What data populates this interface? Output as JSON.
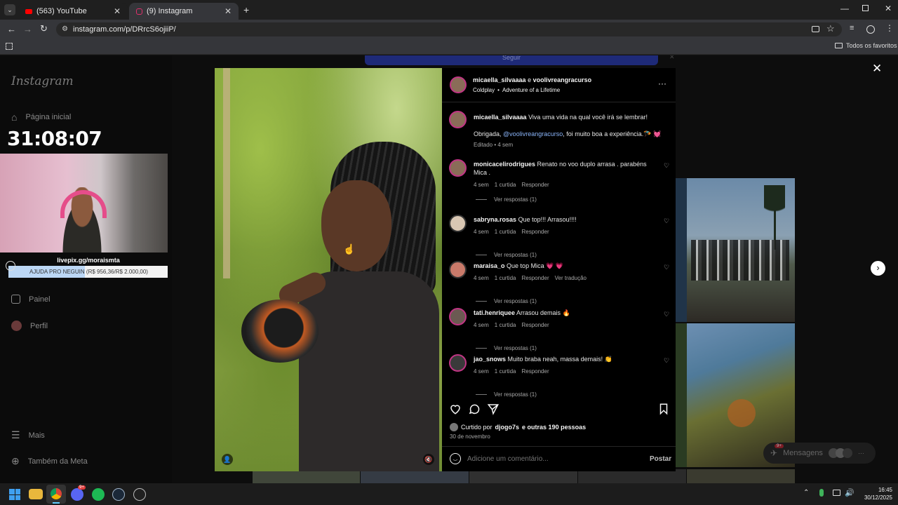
{
  "browser": {
    "tabs": [
      {
        "label": "(563) YouTube",
        "active": false
      },
      {
        "label": "(9) Instagram",
        "active": true
      }
    ],
    "url": "instagram.com/p/DRrcS6ojiiP/",
    "bookmarks_label": "Todos os favoritos"
  },
  "instagram": {
    "logo": "Instagram",
    "follow_label": "Seguir",
    "sidebar": {
      "home": "Página inicial",
      "panel": "Painel",
      "profile": "Perfil",
      "more": "Mais",
      "meta": "Também da Meta"
    },
    "messages_label": "Mensagens",
    "messages_badge": "9+"
  },
  "stream_overlay": {
    "timer": "31:08:07",
    "link": "livepix.gg/moraismta",
    "goal_text": "AJUDA PRO NEGUIN (R$ 956,36/R$ 2.000,00)",
    "goal_progress": 0.478
  },
  "post": {
    "author": "micaella_silvaaaa",
    "and_text": "e",
    "collaborator": "voolivreangracurso",
    "music_artist": "Coldplay",
    "music_sep": "•",
    "music_song": "Adventure of a Lifetime",
    "caption_line1": "Viva uma vida na qual você irá se lembrar!",
    "caption_pre": "Obrigada,",
    "caption_mention": "@voolivreangracurso",
    "caption_post": ", foi muito boa a experiência.🪂 💓",
    "caption_meta": "Editado • 4 sem",
    "comments": [
      {
        "user": "monicacelirodrigues",
        "text": "Renato no voo duplo arrasa . parabéns Mica .",
        "age": "4 sem",
        "likes": "1 curtida",
        "reply": "Responder",
        "translate": "",
        "replies": "Ver respostas (1)"
      },
      {
        "user": "sabryna.rosas",
        "text": "Que top!!! Arrasou!!!!",
        "age": "4 sem",
        "likes": "1 curtida",
        "reply": "Responder",
        "translate": "",
        "replies": "Ver respostas (1)"
      },
      {
        "user": "maraisa_o",
        "text": "Que top Mica 💗 💗",
        "age": "4 sem",
        "likes": "1 curtida",
        "reply": "Responder",
        "translate": "Ver tradução",
        "replies": "Ver respostas (1)"
      },
      {
        "user": "tati.henriquee",
        "text": "Arrasou demais 🔥",
        "age": "4 sem",
        "likes": "1 curtida",
        "reply": "Responder",
        "translate": "",
        "replies": "Ver respostas (1)"
      },
      {
        "user": "jao_snows",
        "text": "Muito braba neah, massa demais! 👏",
        "age": "4 sem",
        "likes": "1 curtida",
        "reply": "Responder",
        "translate": "",
        "replies": "Ver respostas (1)"
      }
    ],
    "liked_by_prefix": "Curtido por",
    "liked_by_user": "djogo7s",
    "liked_by_suffix": "e outras 190 pessoas",
    "date": "30 de novembro",
    "comment_placeholder": "Adicione um comentário...",
    "post_button": "Postar"
  },
  "taskbar": {
    "time": "16:45",
    "date": "30/12/2025",
    "discord_badge": "9+"
  },
  "icons": [
    "home-icon",
    "panel-icon",
    "menu-icon",
    "meta-icon",
    "heart-icon",
    "comment-icon",
    "share-icon",
    "bookmark-icon",
    "emoji-icon",
    "close-icon",
    "next-icon",
    "mute-icon",
    "user-tag-icon",
    "more-icon"
  ],
  "colors": {
    "link": "#8ab4f8",
    "accent": "#0095f6",
    "stream_goal": "#bcd7f5"
  }
}
